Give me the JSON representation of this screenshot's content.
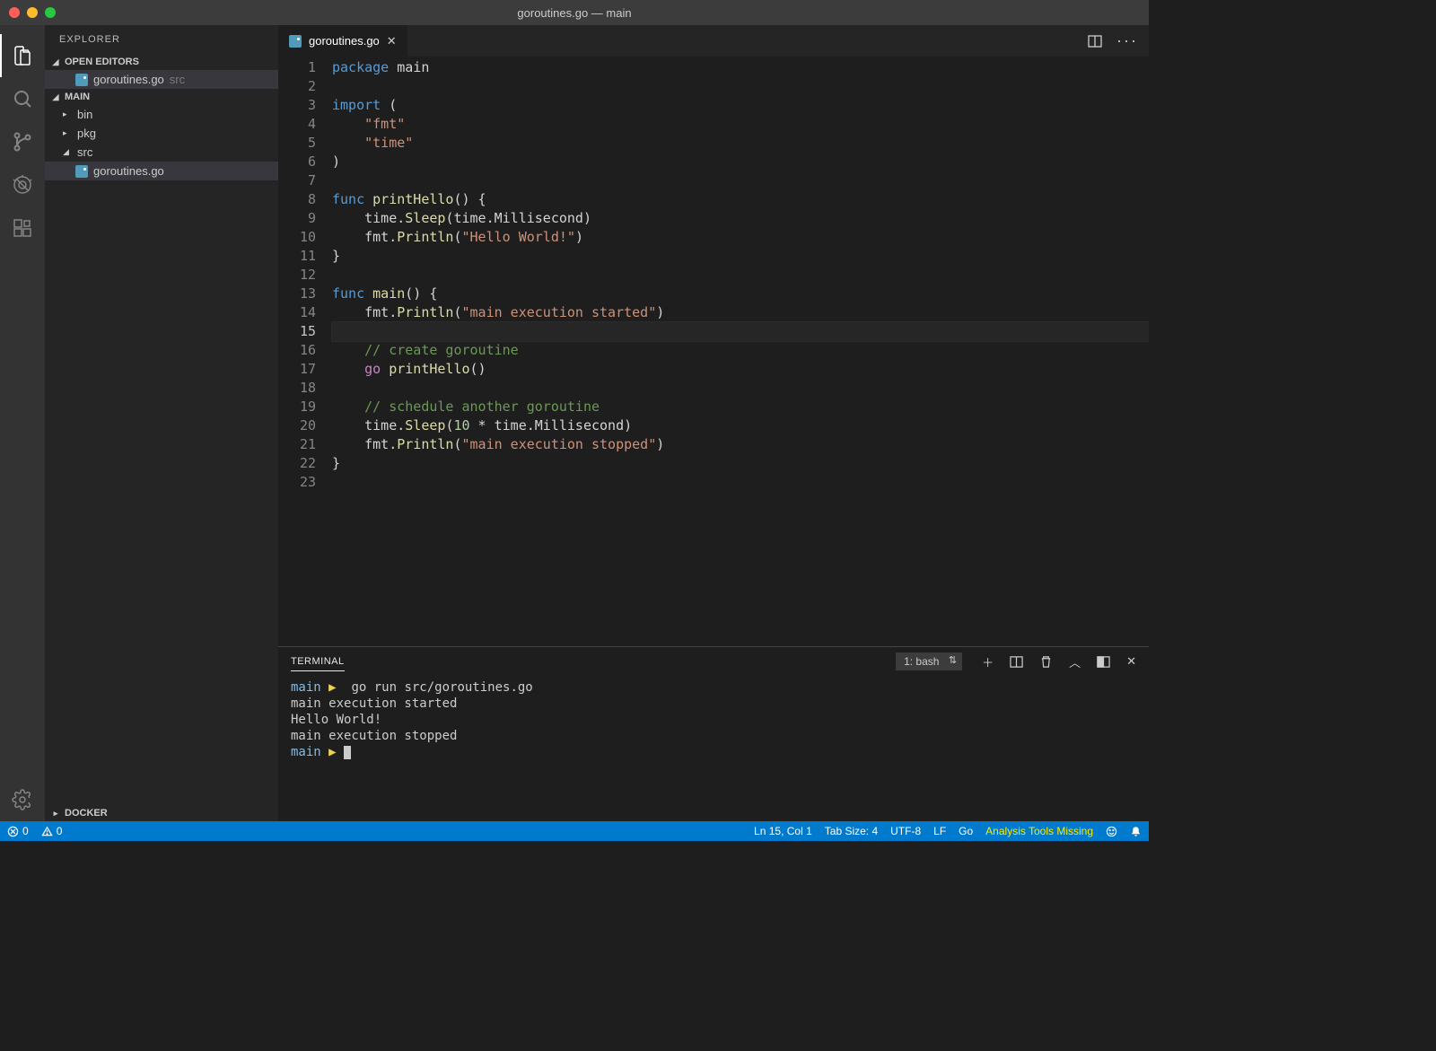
{
  "window": {
    "title": "goroutines.go — main"
  },
  "sidebar": {
    "title": "EXPLORER",
    "openEditorsLabel": "OPEN EDITORS",
    "openEditors": [
      {
        "name": "goroutines.go",
        "dir": "src"
      }
    ],
    "workspaceLabel": "MAIN",
    "tree": [
      {
        "name": "bin",
        "type": "folder",
        "expanded": false
      },
      {
        "name": "pkg",
        "type": "folder",
        "expanded": false
      },
      {
        "name": "src",
        "type": "folder",
        "expanded": true,
        "children": [
          {
            "name": "goroutines.go",
            "type": "go",
            "selected": true
          }
        ]
      }
    ],
    "dockerLabel": "DOCKER"
  },
  "tabs": {
    "open": [
      {
        "name": "goroutines.go",
        "active": true
      }
    ]
  },
  "editor": {
    "currentLine": 15,
    "lines": [
      [
        {
          "t": "package ",
          "c": "keyword"
        },
        {
          "t": "main",
          "c": "ident"
        }
      ],
      [],
      [
        {
          "t": "import ",
          "c": "keyword"
        },
        {
          "t": "(",
          "c": "punct"
        }
      ],
      [
        {
          "t": "    ",
          "c": "punct"
        },
        {
          "t": "\"fmt\"",
          "c": "string"
        }
      ],
      [
        {
          "t": "    ",
          "c": "punct"
        },
        {
          "t": "\"time\"",
          "c": "string"
        }
      ],
      [
        {
          "t": ")",
          "c": "punct"
        }
      ],
      [],
      [
        {
          "t": "func ",
          "c": "keyword"
        },
        {
          "t": "printHello",
          "c": "func"
        },
        {
          "t": "() {",
          "c": "punct"
        }
      ],
      [
        {
          "t": "    time.",
          "c": "ident"
        },
        {
          "t": "Sleep",
          "c": "func"
        },
        {
          "t": "(time.Millisecond)",
          "c": "ident"
        }
      ],
      [
        {
          "t": "    fmt.",
          "c": "ident"
        },
        {
          "t": "Println",
          "c": "func"
        },
        {
          "t": "(",
          "c": "punct"
        },
        {
          "t": "\"Hello World!\"",
          "c": "string"
        },
        {
          "t": ")",
          "c": "punct"
        }
      ],
      [
        {
          "t": "}",
          "c": "punct"
        }
      ],
      [],
      [
        {
          "t": "func ",
          "c": "keyword"
        },
        {
          "t": "main",
          "c": "func"
        },
        {
          "t": "() {",
          "c": "punct"
        }
      ],
      [
        {
          "t": "    fmt.",
          "c": "ident"
        },
        {
          "t": "Println",
          "c": "func"
        },
        {
          "t": "(",
          "c": "punct"
        },
        {
          "t": "\"main execution started\"",
          "c": "string"
        },
        {
          "t": ")",
          "c": "punct"
        }
      ],
      [],
      [
        {
          "t": "    ",
          "c": "punct"
        },
        {
          "t": "// create goroutine",
          "c": "comment"
        }
      ],
      [
        {
          "t": "    ",
          "c": "punct"
        },
        {
          "t": "go ",
          "c": "control"
        },
        {
          "t": "printHello",
          "c": "func"
        },
        {
          "t": "()",
          "c": "punct"
        }
      ],
      [],
      [
        {
          "t": "    ",
          "c": "punct"
        },
        {
          "t": "// schedule another goroutine",
          "c": "comment"
        }
      ],
      [
        {
          "t": "    time.",
          "c": "ident"
        },
        {
          "t": "Sleep",
          "c": "func"
        },
        {
          "t": "(",
          "c": "punct"
        },
        {
          "t": "10",
          "c": "number"
        },
        {
          "t": " * time.Millisecond)",
          "c": "ident"
        }
      ],
      [
        {
          "t": "    fmt.",
          "c": "ident"
        },
        {
          "t": "Println",
          "c": "func"
        },
        {
          "t": "(",
          "c": "punct"
        },
        {
          "t": "\"main execution stopped\"",
          "c": "string"
        },
        {
          "t": ")",
          "c": "punct"
        }
      ],
      [
        {
          "t": "}",
          "c": "punct"
        }
      ],
      []
    ]
  },
  "terminal": {
    "tabLabel": "TERMINAL",
    "selector": "1: bash",
    "lines": [
      [
        {
          "t": "main",
          "c": "dir"
        },
        {
          "t": " ▶ ",
          "c": "sym"
        },
        {
          "t": " go run src/goroutines.go",
          "c": ""
        }
      ],
      [
        {
          "t": "main execution started",
          "c": ""
        }
      ],
      [
        {
          "t": "Hello World!",
          "c": ""
        }
      ],
      [
        {
          "t": "main execution stopped",
          "c": ""
        }
      ],
      [
        {
          "t": "main",
          "c": "dir"
        },
        {
          "t": " ▶ ",
          "c": "sym"
        },
        {
          "t": "",
          "c": "cursor"
        }
      ]
    ]
  },
  "status": {
    "errors": "0",
    "warnings": "0",
    "lineCol": "Ln 15, Col 1",
    "tabSize": "Tab Size: 4",
    "encoding": "UTF-8",
    "eol": "LF",
    "language": "Go",
    "message": "Analysis Tools Missing"
  }
}
